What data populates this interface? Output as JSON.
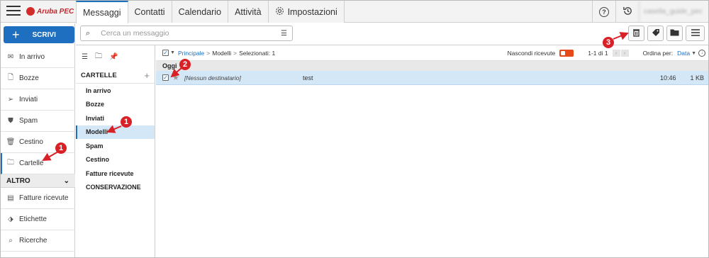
{
  "brand": {
    "logo_text": "Aruba PEC",
    "accent": "#1e6fbf",
    "logo_color": "#c0272d"
  },
  "topbar": {
    "tabs": [
      {
        "label": "Messaggi",
        "active": true
      },
      {
        "label": "Contatti"
      },
      {
        "label": "Calendario"
      },
      {
        "label": "Attività"
      },
      {
        "label": "Impostazioni",
        "icon": "gear-icon"
      }
    ],
    "help_icon": "?",
    "user_label": "casella_guide_pec"
  },
  "compose": {
    "label": "SCRIVI",
    "plus": "+"
  },
  "sidebar": {
    "items": [
      {
        "label": "In arrivo",
        "icon": "envelope-icon",
        "glyph": "✉"
      },
      {
        "label": "Bozze",
        "icon": "draft-icon",
        "glyph": "🗋"
      },
      {
        "label": "Inviati",
        "icon": "send-icon",
        "glyph": "➢"
      },
      {
        "label": "Spam",
        "icon": "spam-shield-icon",
        "glyph": "⛊"
      },
      {
        "label": "Cestino",
        "icon": "trash-icon",
        "glyph": "🗑"
      },
      {
        "label": "Cartelle",
        "icon": "folder-icon",
        "glyph": "🗀"
      }
    ],
    "altro_label": "ALTRO",
    "altro_items": [
      {
        "label": "Fatture ricevute",
        "icon": "invoice-icon",
        "glyph": "▤"
      },
      {
        "label": "Etichette",
        "icon": "tag-icon",
        "glyph": "⬗"
      },
      {
        "label": "Ricerche",
        "icon": "search-icon",
        "glyph": "⌕"
      }
    ]
  },
  "search": {
    "placeholder": "Cerca un messaggio"
  },
  "folders": {
    "header": "CARTELLE",
    "add": "+",
    "items": [
      "In arrivo",
      "Bozze",
      "Inviati",
      "Modelli",
      "Spam",
      "Cestino",
      "Fatture ricevute",
      "CONSERVAZIONE"
    ],
    "active_index": 3
  },
  "list": {
    "breadcrumb": {
      "root": "Principale",
      "sep": ">",
      "current": "Modelli",
      "selected": "Selezionati: 1"
    },
    "hide_read_label": "Nascondi ricevute",
    "page_info": "1-1 di 1",
    "sort_label": "Ordina per:",
    "sort_value": "Data",
    "group": "Oggi",
    "rows": [
      {
        "recipient": "[Nessun destinatario]",
        "subject": "test",
        "time": "10:46",
        "size": "1 KB",
        "checked": true
      }
    ]
  },
  "callouts": [
    "1",
    "1",
    "2",
    "3"
  ]
}
